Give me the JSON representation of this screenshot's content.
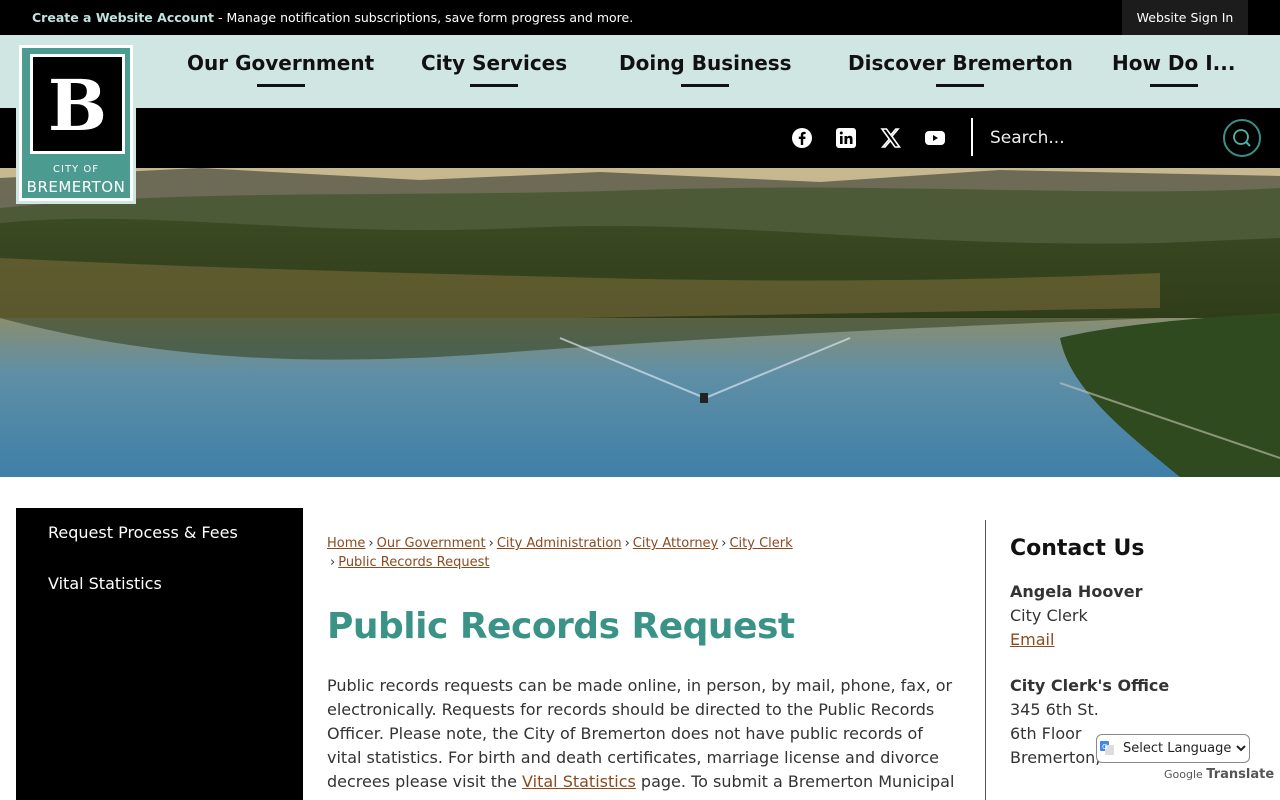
{
  "topbar": {
    "account_link": "Create a Website Account",
    "message": " - Manage notification subscriptions, save form progress and more.",
    "signin": "Website Sign In"
  },
  "logo": {
    "line1": "CITY OF",
    "line2": "BREMERTON",
    "letter": "B"
  },
  "nav": {
    "items": [
      "Our Government",
      "City Services",
      "Doing Business",
      "Discover Bremerton",
      "How Do I..."
    ]
  },
  "social": {
    "icons": [
      "facebook-icon",
      "linkedin-icon",
      "x-icon",
      "youtube-icon"
    ]
  },
  "search": {
    "placeholder": "Search..."
  },
  "sidebar": {
    "items": [
      "Request Process & Fees",
      "Vital Statistics"
    ]
  },
  "breadcrumb": {
    "items": [
      "Home",
      "Our Government",
      "City Administration",
      "City Attorney",
      "City Clerk",
      "Public Records Request"
    ],
    "separator": "›"
  },
  "page": {
    "title": "Public Records Request",
    "body_part1": "Public records requests can be made online, in person, by mail, phone, fax, or electronically. Requests for records should be directed to the Public Records Officer. Please note, the City of Bremerton does not have public records of vital statistics. For birth and death certificates, marriage license and divorce decrees please visit the ",
    "body_link": "Vital Statistics",
    "body_part2": " page. To submit a Bremerton Municipal"
  },
  "contact": {
    "heading": "Contact Us",
    "name": "Angela Hoover",
    "role": "City Clerk",
    "email_link": "Email",
    "office": "City Clerk's Office",
    "address1": "345 6th St.",
    "address2": "6th Floor",
    "address3": "Bremerton,"
  },
  "translate": {
    "select_label": "Select Language",
    "powered_prefix": "Google",
    "powered_word": "Translate"
  },
  "colors": {
    "teal": "#3b9387",
    "nav_bg": "#cfe6e2",
    "link": "#8a4b1f"
  }
}
